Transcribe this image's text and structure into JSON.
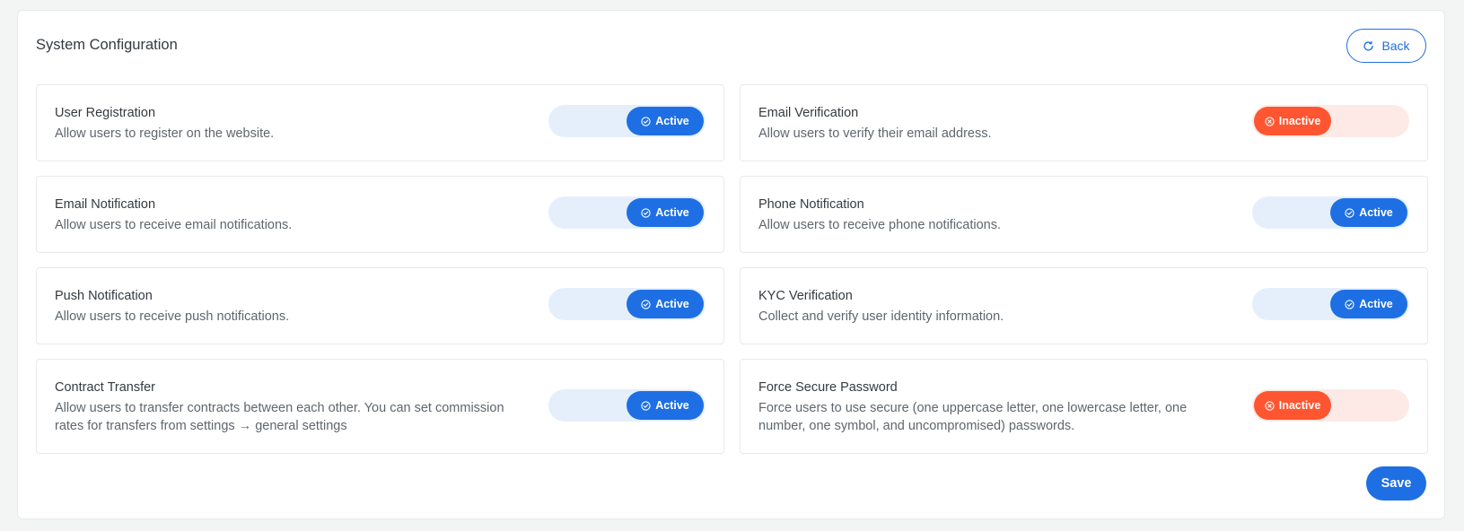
{
  "page": {
    "title": "System Configuration",
    "back_label": "Back",
    "save_label": "Save"
  },
  "colors": {
    "accent": "#1e6fe3",
    "inactive": "#ff5530",
    "active_track": "#e5effc",
    "inactive_track": "#fdeae6"
  },
  "settings": [
    {
      "title": "User Registration",
      "description": "Allow users to register on the website.",
      "status": "Active"
    },
    {
      "title": "Email Verification",
      "description": "Allow users to verify their email address.",
      "status": "Inactive"
    },
    {
      "title": "Email Notification",
      "description": "Allow users to receive email notifications.",
      "status": "Active"
    },
    {
      "title": "Phone Notification",
      "description": "Allow users to receive phone notifications.",
      "status": "Active"
    },
    {
      "title": "Push Notification",
      "description": "Allow users to receive push notifications.",
      "status": "Active"
    },
    {
      "title": "KYC Verification",
      "description": "Collect and verify user identity information.",
      "status": "Active"
    },
    {
      "title": "Contract Transfer",
      "description": "Allow users to transfer contracts between each other. You can set commission rates for transfers from settings → general settings",
      "status": "Active"
    },
    {
      "title": "Force Secure Password",
      "description": "Force users to use secure (one uppercase letter, one lowercase letter, one number, one symbol, and uncompromised) passwords.",
      "status": "Inactive"
    }
  ]
}
